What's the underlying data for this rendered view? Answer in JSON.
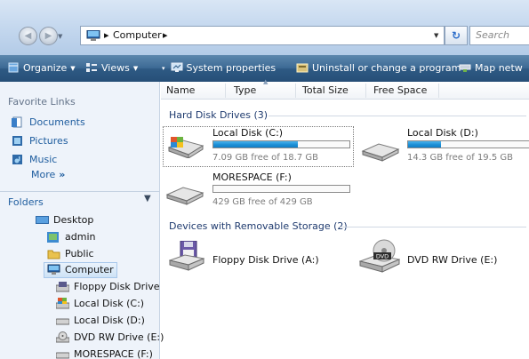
{
  "address": {
    "path": [
      "Computer"
    ],
    "search_placeholder": "Search"
  },
  "toolbar": {
    "organize": "Organize",
    "views": "Views",
    "system_properties": "System properties",
    "uninstall": "Uninstall or change a program",
    "map_network": "Map netw"
  },
  "nav": {
    "favorite_links_title": "Favorite Links",
    "links": [
      "Documents",
      "Pictures",
      "Music"
    ],
    "more": "More",
    "more_arrows": "»",
    "folders_title": "Folders",
    "tree": [
      "Desktop",
      "admin",
      "Public",
      "Computer",
      "Floppy Disk Drive",
      "Local Disk (C:)",
      "Local Disk (D:)",
      "DVD RW Drive (E:)",
      "MORESPACE (F:)"
    ]
  },
  "columns": [
    "Name",
    "Type",
    "Total Size",
    "Free Space"
  ],
  "groups": {
    "hdd": "Hard Disk Drives (3)",
    "removable": "Devices with Removable Storage (2)"
  },
  "drives": [
    {
      "name": "Local Disk (C:)",
      "free": "7.09 GB free of 18.7 GB",
      "used_fraction": 0.62
    },
    {
      "name": "Local Disk (D:)",
      "free": "14.3 GB free of 19.5 GB",
      "used_fraction": 0.27
    },
    {
      "name": "MORESPACE (F:)",
      "free": "429 GB free of 429 GB",
      "used_fraction": 0.0
    }
  ],
  "removable": [
    {
      "name": "Floppy Disk Drive (A:)"
    },
    {
      "name": "DVD RW Drive (E:)",
      "badge": "DVD"
    }
  ],
  "colors": {
    "command_bar": "#2e5a84",
    "link": "#1d5c9e",
    "progress": "#1c8fd6"
  }
}
